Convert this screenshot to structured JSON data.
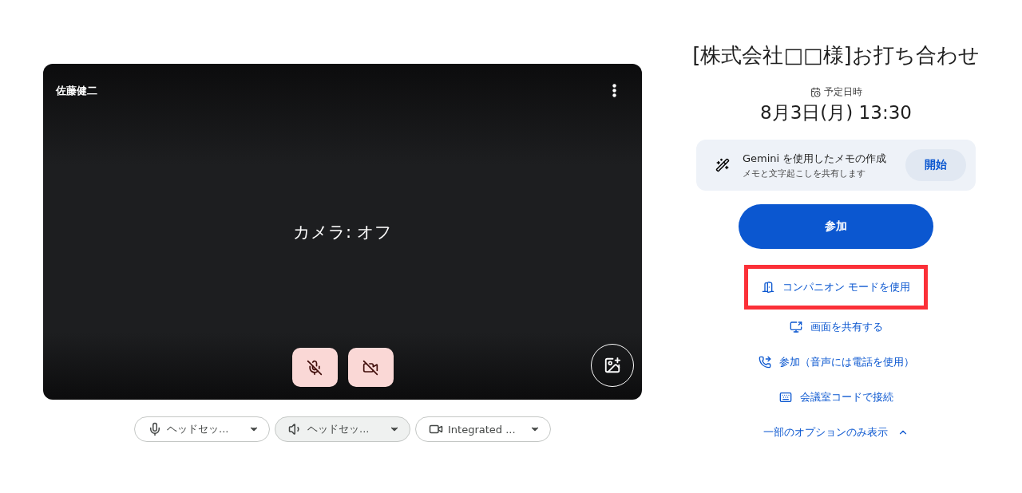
{
  "preview": {
    "participant": "佐藤健二",
    "status": "カメラ: オフ",
    "mic_on": false,
    "camera_on": false
  },
  "devices": [
    {
      "kind": "mic",
      "label": "ヘッドセッ...",
      "selected": false
    },
    {
      "kind": "speaker",
      "label": "ヘッドセッ...",
      "selected": true
    },
    {
      "kind": "camera",
      "label": "Integrated ...",
      "selected": false
    }
  ],
  "meeting": {
    "title": "[株式会社□□様]お打ち合わせ",
    "schedule_label": "予定日時",
    "schedule": "8月3日(月)  13:30"
  },
  "gemini": {
    "title": "Gemini を使用したメモの作成",
    "subtitle": "メモと文字起こしを共有します",
    "button": "開始"
  },
  "join_button": "参加",
  "options": [
    {
      "kind": "companion",
      "label": "コンパニオン モードを使用",
      "highlighted": true
    },
    {
      "kind": "present",
      "label": "画面を共有する",
      "highlighted": false
    },
    {
      "kind": "phone",
      "label": "参加（音声には電話を使用）",
      "highlighted": false
    },
    {
      "kind": "room",
      "label": "会議室コードで接続",
      "highlighted": false
    }
  ],
  "toggle": {
    "label": "一部のオプションのみ表示",
    "expanded": true
  }
}
